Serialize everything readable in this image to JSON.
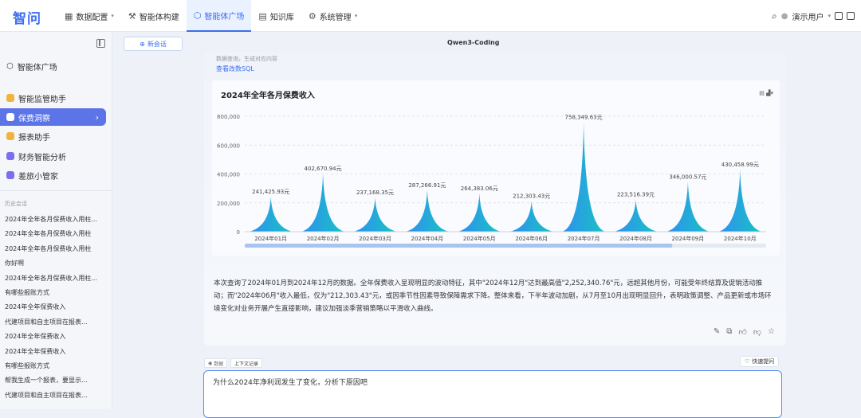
{
  "app": {
    "logo": "智问"
  },
  "nav": [
    {
      "label": "数据配置",
      "icon": "settings-grid-icon",
      "glyph": "▦",
      "dropdown": true,
      "active": false
    },
    {
      "label": "智能体构建",
      "icon": "build-icon",
      "glyph": "⚒",
      "dropdown": false,
      "active": false
    },
    {
      "label": "智能体广场",
      "icon": "cube-icon",
      "glyph": "⬡",
      "dropdown": false,
      "active": true
    },
    {
      "label": "知识库",
      "icon": "book-icon",
      "glyph": "▤",
      "dropdown": false,
      "active": false
    },
    {
      "label": "系统管理",
      "icon": "gear-icon",
      "glyph": "⚙",
      "dropdown": true,
      "active": false
    }
  ],
  "topright": {
    "user": "演示用户"
  },
  "sidebar": {
    "plaza_label": "智能体广场",
    "agents": [
      {
        "label": "智能监管助手",
        "color": "#f2b33d",
        "selected": false
      },
      {
        "label": "保费洞察",
        "color": "#f2b33d",
        "selected": true
      },
      {
        "label": "报表助手",
        "color": "#f2b33d",
        "selected": false
      },
      {
        "label": "财务智能分析",
        "color": "#7a6ff0",
        "selected": false
      },
      {
        "label": "差旅小管家",
        "color": "#7a6ff0",
        "selected": false
      }
    ],
    "history_title": "历史会话",
    "history": [
      "2024年全年各月保费收入用柱...",
      "2024年全年各月保费收入用柱",
      "2024年全年各月保费收入用柱",
      "你好啊",
      "2024年全年各月保费收入用柱...",
      "有哪些报账方式",
      "2024年全年保费收入",
      "代建项目和自主项目在报表...",
      "2024年全年保费收入",
      "2024年全年保费收入",
      "有哪些报账方式",
      "帮我生成一个报表，要显示...",
      "代建项目和自主项目在报表..."
    ]
  },
  "main": {
    "new_chat": "新会话",
    "model": "Qwen3-Coding",
    "faded_text": "数据查询，生成对应内容",
    "sql_link": "查看改数SQL",
    "summary": "本次查询了2024年01月到2024年12月的数据。全年保费收入呈现明显的波动特征，其中\"2024年12月\"达到最高值\"2,252,340.76\"元，远超其他月份，可能受年终结算及促销活动推动；而\"2024年06月\"收入最低，仅为\"212,303.43\"元，或因季节性因素导致保障需求下降。整体来看，下半年波动加剧，从7月至10月出现明显回升，表明政策调整、产品更新或市场环境变化对业务开展产生直接影响，建议加强淡季营销策略以平滑收入曲线。",
    "chip_left": "数据",
    "chip_right": "上下文记录",
    "quick_ask": "快速提问",
    "input_text": "为什么2024年净利润发生了变化，分析下原因吧"
  },
  "chart_data": {
    "type": "area",
    "title": "2024年全年各月保费收入",
    "categories": [
      "2024年01月",
      "2024年02月",
      "2024年03月",
      "2024年04月",
      "2024年05月",
      "2024年06月",
      "2024年07月",
      "2024年08月",
      "2024年09月",
      "2024年10月"
    ],
    "values": [
      241425.93,
      402670.94,
      237168.35,
      287266.91,
      264383.06,
      212303.43,
      758349.63,
      223516.39,
      346000.57,
      430458.99
    ],
    "value_labels": [
      "241,425.93元",
      "402,670.94元",
      "237,168.35元",
      "287,266.91元",
      "264,383.06元",
      "212,303.43元",
      "758,349.63元",
      "223,516.39元",
      "346,000.57元",
      "430,458.99元"
    ],
    "yticks": [
      "0",
      "200,000",
      "400,000",
      "600,000",
      "800,000"
    ],
    "ylim": [
      0,
      800000
    ],
    "grid": true,
    "color_start": "#2f8ff0",
    "color_end": "#19c3c3",
    "legend": "none"
  }
}
